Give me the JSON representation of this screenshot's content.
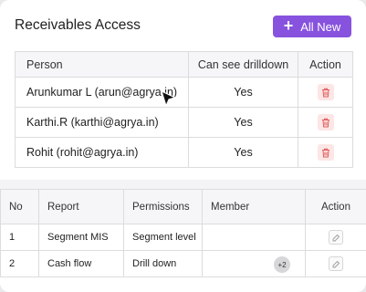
{
  "header": {
    "title": "Receivables Access",
    "add_button_label": "All New",
    "add_icon": "plus-icon"
  },
  "access_table": {
    "columns": [
      "Person",
      "Can see drilldown",
      "Action"
    ],
    "rows": [
      {
        "person": "Arunkumar L (arun@agrya.in)",
        "drilldown": "Yes",
        "action_icon": "trash-icon"
      },
      {
        "person": "Karthi.R (karthi@agrya.in)",
        "drilldown": "Yes",
        "action_icon": "trash-icon"
      },
      {
        "person": "Rohit (rohit@agrya.in)",
        "drilldown": "Yes",
        "action_icon": "trash-icon"
      }
    ]
  },
  "reports_table": {
    "columns": [
      "No",
      "Report",
      "Permissions",
      "Member",
      "Action"
    ],
    "rows": [
      {
        "no": "1",
        "report": "Segment MIS",
        "permissions": "Segment level",
        "member_badge": "",
        "action_icon": "edit-icon"
      },
      {
        "no": "2",
        "report": "Cash flow",
        "permissions": "Drill down",
        "member_badge": "+2",
        "action_icon": "edit-icon"
      }
    ]
  },
  "colors": {
    "accent": "#8753de",
    "delete_bg": "#fde6e6",
    "delete_icon": "#e05c5c",
    "border": "#dcdcdf",
    "header_bg": "#f6f6f8"
  }
}
